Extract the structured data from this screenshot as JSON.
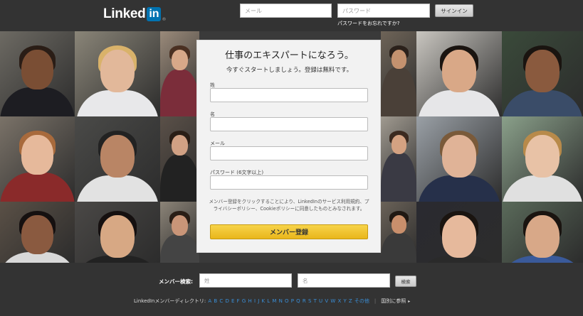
{
  "header": {
    "logo_text": "Linked",
    "logo_in": "in",
    "logo_reg": "®",
    "email_placeholder": "メール",
    "password_placeholder": "パスワード",
    "signin_label": "サインイン",
    "forgot_password": "パスワードをお忘れですか?"
  },
  "signup": {
    "title": "仕事のエキスパートになろう。",
    "subtitle": "今すぐスタートしましょう。登録は無料です。",
    "last_name_label": "姓",
    "first_name_label": "名",
    "email_label": "メール",
    "password_label": "パスワード (6文字以上)",
    "terms_text": "メンバー登録をクリックすることにより、LinkedInのサービス利用規約、プライバシーポリシー、Cookieポリシーに同意したものとみなされます。",
    "join_label": "メンバー登録"
  },
  "footer": {
    "search_label": "メンバー検索:",
    "last_name_placeholder": "姓",
    "first_name_placeholder": "名",
    "search_button": "検索",
    "directory_label": "LinkedInメンバーディレクトリ:",
    "letters": [
      "A",
      "B",
      "C",
      "D",
      "E",
      "F",
      "G",
      "H",
      "I",
      "J",
      "K",
      "L",
      "M",
      "N",
      "O",
      "P",
      "Q",
      "R",
      "S",
      "T",
      "U",
      "V",
      "W",
      "X",
      "Y",
      "Z",
      "その他"
    ],
    "country_link": "国別に参照",
    "arrow": "▸"
  },
  "colors": {
    "header_bg": "#333333",
    "brand_blue": "#0073b1",
    "join_yellow": "#f0c330",
    "link_blue": "#3a8fd8"
  }
}
